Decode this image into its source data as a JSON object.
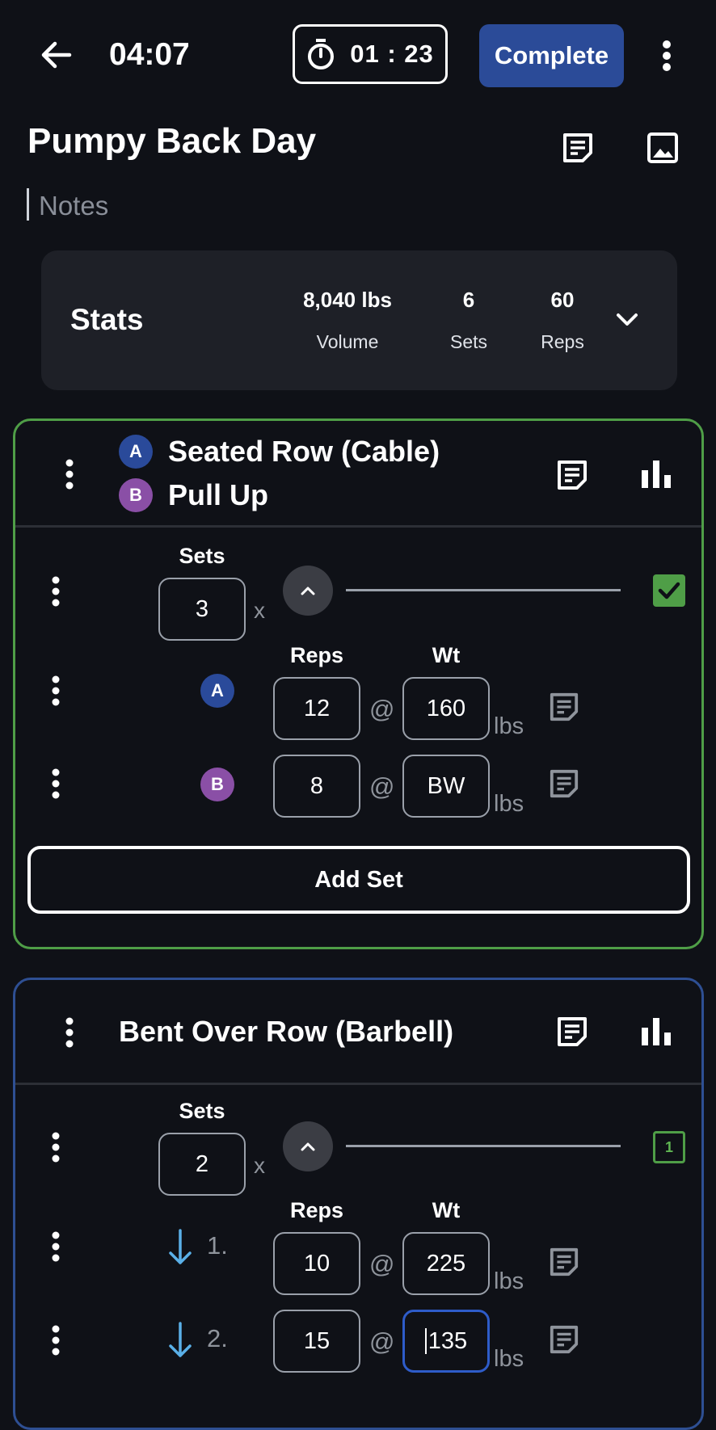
{
  "header": {
    "elapsed_time": "04:07",
    "rest_timer": "01 : 23",
    "complete_label": "Complete"
  },
  "workout": {
    "title": "Pumpy Back Day",
    "notes_placeholder": "Notes"
  },
  "stats": {
    "label": "Stats",
    "items": [
      {
        "value": "8,040 lbs",
        "label": "Volume"
      },
      {
        "value": "6",
        "label": "Sets"
      },
      {
        "value": "60",
        "label": "Reps"
      }
    ]
  },
  "exercises": [
    {
      "superset": [
        {
          "badge": "A",
          "name": "Seated Row (Cable)",
          "color": "#2a4a9a"
        },
        {
          "badge": "B",
          "name": "Pull Up",
          "color": "#8a4fa6"
        }
      ],
      "border_color": "#4f9e47",
      "sets_header": "Sets",
      "sets_value": "3",
      "x_label": "x",
      "reps_header": "Reps",
      "wt_header": "Wt",
      "rows": [
        {
          "marker": "A",
          "reps": "12",
          "at": "@",
          "weight": "160",
          "unit": "lbs"
        },
        {
          "marker": "B",
          "reps": "8",
          "at": "@",
          "weight": "BW",
          "unit": "lbs"
        }
      ],
      "add_set_label": "Add Set"
    },
    {
      "name": "Bent Over Row (Barbell)",
      "border_color": "#2e4f93",
      "sets_header": "Sets",
      "sets_value": "2",
      "x_label": "x",
      "completed_count": "1",
      "reps_header": "Reps",
      "wt_header": "Wt",
      "rows": [
        {
          "number": "1.",
          "reps": "10",
          "at": "@",
          "weight": "225",
          "unit": "lbs"
        },
        {
          "number": "2.",
          "reps": "15",
          "at": "@",
          "weight": "135",
          "unit": "lbs"
        }
      ]
    }
  ]
}
